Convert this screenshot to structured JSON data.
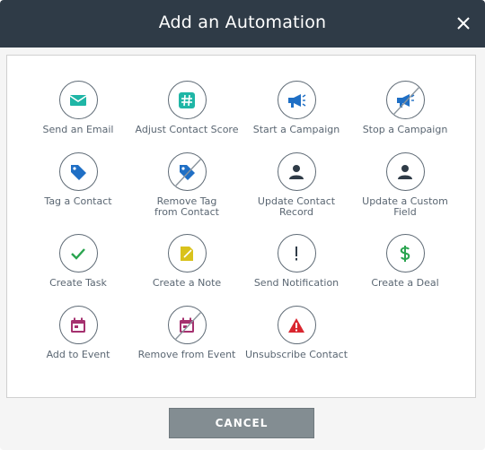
{
  "dialog": {
    "title": "Add an Automation",
    "cancel_label": "CANCEL"
  },
  "colors": {
    "header_bg": "#2f3b47",
    "teal": "#1fb6a6",
    "blue": "#1f6fc5",
    "green": "#2aa44f",
    "yellow": "#d9c21c",
    "magenta": "#a5316f",
    "red": "#d9262f",
    "dark": "#2f3b47"
  },
  "actions": [
    {
      "label": "Send an Email",
      "icon": "envelope-icon"
    },
    {
      "label": "Adjust Contact Score",
      "icon": "hashtag-icon"
    },
    {
      "label": "Start a Campaign",
      "icon": "megaphone-icon"
    },
    {
      "label": "Stop a Campaign",
      "icon": "megaphone-off-icon"
    },
    {
      "label": "Tag a Contact",
      "icon": "tag-icon"
    },
    {
      "label": "Remove Tag from Contact",
      "icon": "tag-off-icon"
    },
    {
      "label": "Update Contact Record",
      "icon": "person-icon"
    },
    {
      "label": "Update a Custom Field",
      "icon": "person-icon"
    },
    {
      "label": "Create Task",
      "icon": "checkmark-icon"
    },
    {
      "label": "Create a Note",
      "icon": "note-icon"
    },
    {
      "label": "Send Notification",
      "icon": "exclamation-icon"
    },
    {
      "label": "Create a Deal",
      "icon": "dollar-icon"
    },
    {
      "label": "Add to Event",
      "icon": "calendar-icon"
    },
    {
      "label": "Remove from Event",
      "icon": "calendar-off-icon"
    },
    {
      "label": "Unsubscribe Contact",
      "icon": "warning-icon"
    }
  ]
}
